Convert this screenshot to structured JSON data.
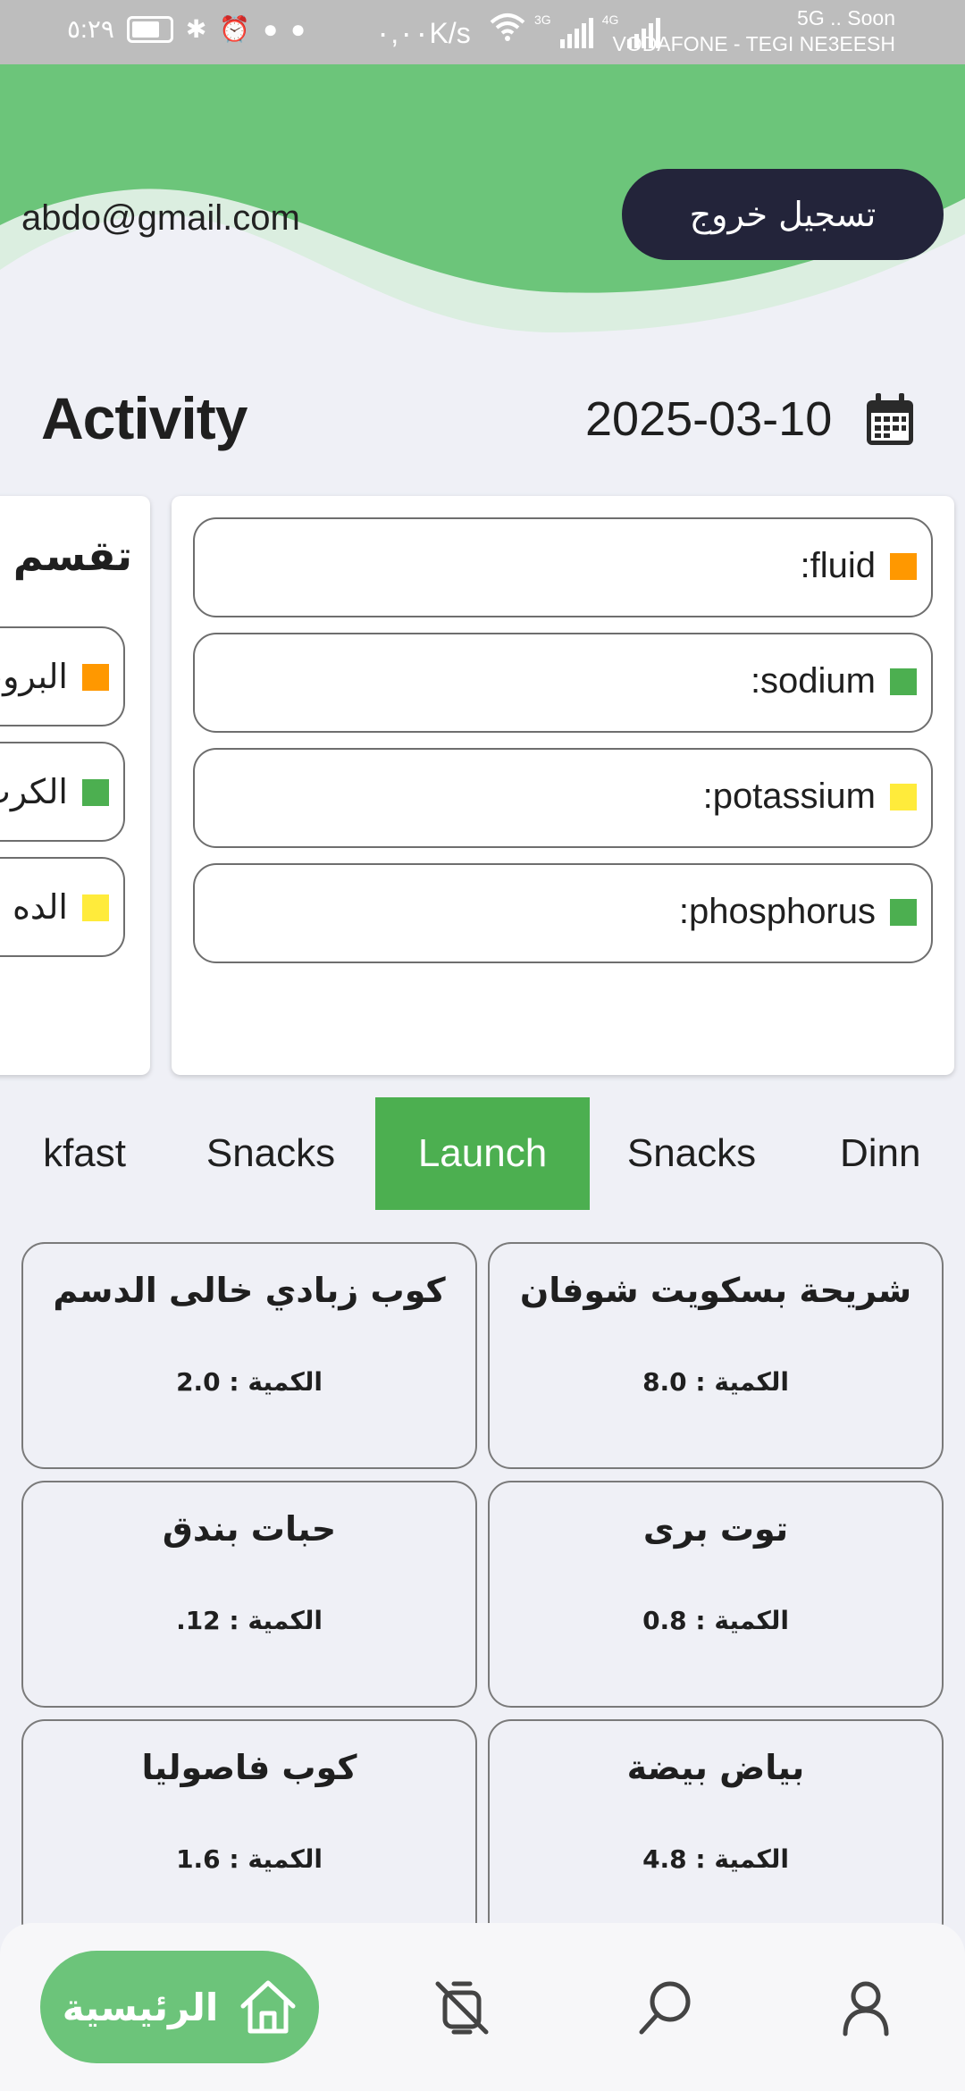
{
  "status_bar": {
    "time": "٥:٢٩",
    "speed": "٠,٠٠K/s",
    "network_3g": "3G",
    "network_4g": "4G",
    "carrier_line1": "5G .. Soon",
    "carrier_line2": "VODAFONE - TEGI NE3EESH"
  },
  "header": {
    "email": "abdo@gmail.com",
    "logout_label": "تسجيل خروج",
    "wave_color": "#6cc57a"
  },
  "activity": {
    "title": "Activity",
    "date": "2025-03-10"
  },
  "minerals": [
    {
      "label": ":fluid",
      "color": "#ff9800"
    },
    {
      "label": ":sodium",
      "color": "#4caf50"
    },
    {
      "label": ":potassium",
      "color": "#ffeb3b"
    },
    {
      "label": ":phosphorus",
      "color": "#4caf50"
    }
  ],
  "macros": {
    "title": "تقسم ال",
    "items": [
      {
        "label": "البروت",
        "color": "#ff9800"
      },
      {
        "label": "الكرب",
        "color": "#4caf50"
      },
      {
        "label": "الده",
        "color": "#ffeb3b"
      }
    ]
  },
  "meal_tabs": [
    {
      "label": "kfast",
      "active": false
    },
    {
      "label": "Snacks",
      "active": false
    },
    {
      "label": "Launch",
      "active": true
    },
    {
      "label": "Snacks",
      "active": false
    },
    {
      "label": "Dinn",
      "active": false
    }
  ],
  "foods": [
    {
      "name": "شريحة بسكويت شوفان",
      "qty": "8.0 : الكمية"
    },
    {
      "name": "كوب زبادي خالى الدسم",
      "qty": "2.0 : الكمية"
    },
    {
      "name": "توت برى",
      "qty": "0.8 : الكمية"
    },
    {
      "name": "حبات بندق",
      "qty": ".12 : الكمية"
    },
    {
      "name": "بياض بيضة",
      "qty": "4.8 : الكمية"
    },
    {
      "name": "كوب فاصوليا",
      "qty": "1.6 : الكمية"
    }
  ],
  "bottom_nav": {
    "home_label": "الرئيسية",
    "accent": "#6cc47a"
  }
}
